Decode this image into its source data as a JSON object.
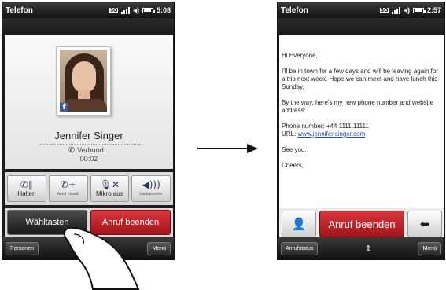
{
  "phone1": {
    "status": {
      "title": "Telefon",
      "time": "5:08"
    },
    "contact": {
      "name": "Jennifer Singer",
      "call_status": "Verbund...",
      "duration": "00:02",
      "facebook_badge": "f"
    },
    "controls": [
      {
        "label": "Halten",
        "icon": "pause-call-icon"
      },
      {
        "label": "Anruf hinzuf.",
        "icon": "add-call-icon"
      },
      {
        "label": "Mikro aus",
        "icon": "mic-mute-icon"
      },
      {
        "label": "Lautsprecher",
        "icon": "speaker-icon"
      }
    ],
    "dialpad_button": "Wähltasten",
    "end_call_button": "Anruf beenden",
    "softkeys": {
      "left": "Personen",
      "right": "Menü"
    }
  },
  "phone2": {
    "status": {
      "title": "Telefon",
      "time": "2:57"
    },
    "message": {
      "greeting": "Hi Everyone,",
      "para1": "I'll be in town for a few days and will be leaving again for a trip next week. Hope we can meet and have lunch this Sunday.",
      "para2": "By the way, here's my new phone number and website address:",
      "phone_line": "Phone number: +44 1111 11111",
      "url_label": "URL: ",
      "url": "www.jennifer.singer.com",
      "closing": "See you.",
      "signoff": "Cheers,"
    },
    "end_call_button": "Anruf beenden",
    "softkeys": {
      "left": "Anrufstatus",
      "right": "Menü"
    }
  },
  "colors": {
    "end_call": "#c0222a",
    "link": "#1a4fc2",
    "status_bar": "#1c1c1c"
  }
}
